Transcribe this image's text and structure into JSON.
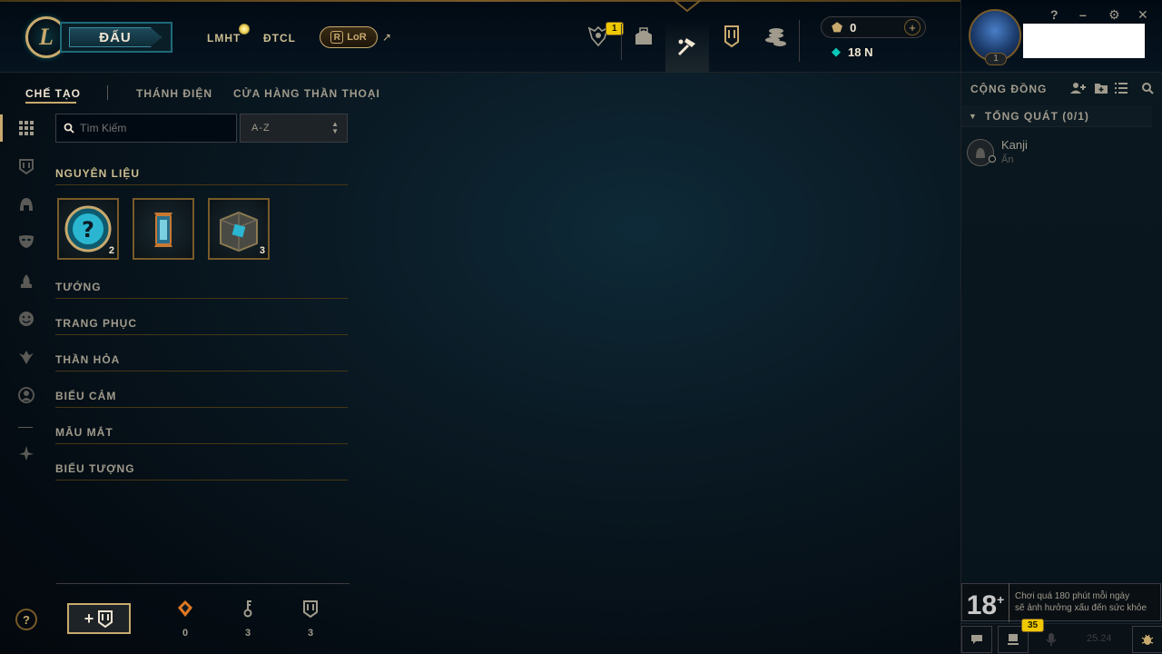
{
  "topbar": {
    "logo_letter": "L",
    "play_label": "ĐẤU",
    "nav_links": [
      "LMHT",
      "ĐTCL"
    ],
    "lor_label": "LoR",
    "lor_letter": "R",
    "lor_ext_icon": "↗",
    "icons": [
      {
        "name": "missions",
        "badge": "1"
      },
      {
        "name": "collection-bag"
      },
      {
        "name": "crafting-hammer"
      },
      {
        "name": "shop-card"
      },
      {
        "name": "store-coins"
      }
    ],
    "blue_essence": "0",
    "orange_essence": "18 N"
  },
  "profile": {
    "level": "1",
    "window_controls": [
      "?",
      "–",
      "⚙",
      "✕"
    ]
  },
  "social": {
    "header": "CỘNG ĐỒNG",
    "group": "TỔNG QUÁT (0/1)",
    "friend_name": "Kanji",
    "friend_status": "Ẩn",
    "age_label": "18",
    "age_plus": "+",
    "age_warning_line1": "Chơi quá 180 phút mỗi ngày",
    "age_warning_line2": "sẽ ảnh hưởng xấu đến sức khỏe",
    "notif_badge": "35",
    "version": "25.24"
  },
  "crafting": {
    "tabs": [
      "CHẾ TẠO",
      "THÁNH ĐIỆN",
      "CỬA HÀNG THẦN THOẠI"
    ],
    "search_placeholder": "Tìm Kiếm",
    "sort_value": "A-Z",
    "categories": [
      {
        "label": "NGUYÊN LIỆU",
        "open": true
      },
      {
        "label": "TƯỚNG"
      },
      {
        "label": "TRANG PHỤC"
      },
      {
        "label": "THẦN HỎA"
      },
      {
        "label": "BIỂU CẢM"
      },
      {
        "label": "MẪU MẮT"
      },
      {
        "label": "BIỂU TƯỢNG"
      }
    ],
    "materials": [
      {
        "name": "mystery-orb",
        "count": "2"
      },
      {
        "name": "lantern-capsule",
        "count": ""
      },
      {
        "name": "hextech-chest",
        "count": "3"
      }
    ],
    "resources": [
      {
        "name": "orange-essence",
        "value": "0"
      },
      {
        "name": "key",
        "value": "3"
      },
      {
        "name": "chest",
        "value": "3"
      }
    ],
    "help_label": "?",
    "craft_plus": "+"
  },
  "colors": {
    "gold": "#c8aa6e",
    "dark_gold": "#785a28",
    "badge_yellow": "#f0c800",
    "teal": "#0ac8b9",
    "text": "#a09b8c"
  }
}
